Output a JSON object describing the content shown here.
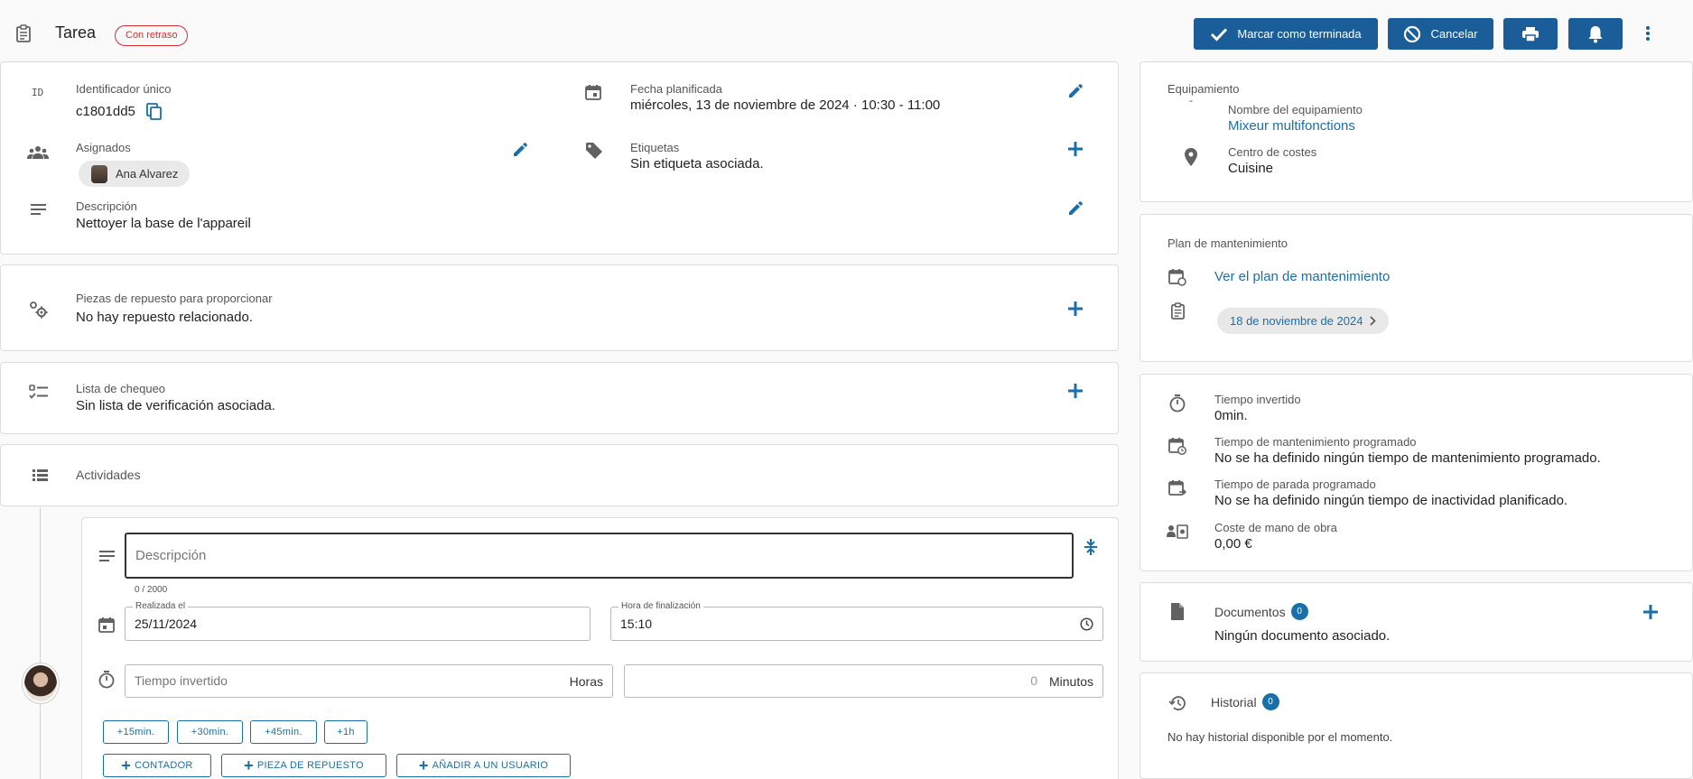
{
  "header": {
    "title": "Tarea",
    "status_badge": "Con retraso",
    "mark_done_label": "Marcar como terminada",
    "cancel_label": "Cancelar"
  },
  "info": {
    "id_icon_text": "ID",
    "id_label": "Identificador único",
    "id_value": "c1801dd5",
    "planned_label": "Fecha planificada",
    "planned_value": "miércoles, 13 de noviembre de 2024 · 10:30 - 11:00",
    "assigned_label": "Asignados",
    "assignee_name": "Ana Alvarez",
    "tags_label": "Etiquetas",
    "tags_value": "Sin etiqueta asociada.",
    "description_label": "Descripción",
    "description_value": "Nettoyer la base de l'appareil"
  },
  "parts": {
    "label": "Piezas de repuesto para proporcionar",
    "value": "No hay repuesto relacionado."
  },
  "checklist": {
    "label": "Lista de chequeo",
    "value": "Sin lista de verificación asociada."
  },
  "activities": {
    "label": "Actividades",
    "description_placeholder": "Descripción",
    "char_count": "0 / 2000",
    "done_on_label": "Realizada el",
    "done_on_value": "25/11/2024",
    "end_time_label": "Hora de finalización",
    "end_time_value": "15:10",
    "time_spent_placeholder": "Tiempo invertido",
    "hours_unit": "Horas",
    "minutes_value": "0",
    "minutes_unit": "Minutos",
    "quick_buttons": [
      "+15min.",
      "+30min.",
      "+45min.",
      "+1h"
    ],
    "add_counter": "CONTADOR",
    "add_part": "PIEZA DE REPUESTO",
    "add_user": "AÑADIR A UN USUARIO"
  },
  "equipment": {
    "title": "Equipamiento",
    "dash": "-",
    "name_label": "Nombre del equipamiento",
    "name_value": "Mixeur multifonctions",
    "cost_center_label": "Centro de costes",
    "cost_center_value": "Cuisine"
  },
  "maintenance_plan": {
    "title": "Plan de mantenimiento",
    "link": "Ver el plan de mantenimiento",
    "date_chip": "18 de noviembre de 2024"
  },
  "times": {
    "spent_label": "Tiempo invertido",
    "spent_value": "0min.",
    "scheduled_label": "Tiempo de mantenimiento programado",
    "scheduled_value": "No se ha definido ningún tiempo de mantenimiento programado.",
    "downtime_label": "Tiempo de parada programado",
    "downtime_value": "No se ha definido ningún tiempo de inactividad planificado.",
    "labor_cost_label": "Coste de mano de obra",
    "labor_cost_value": "0,00 €"
  },
  "documents": {
    "label": "Documentos",
    "count": "0",
    "value": "Ningún documento asociado."
  },
  "history": {
    "label": "Historial",
    "count": "0",
    "value": "No hay historial disponible por el momento."
  },
  "colors": {
    "primary": "#1a5d98",
    "accent": "#1a6fa8",
    "late_badge": "#d32f2f"
  }
}
